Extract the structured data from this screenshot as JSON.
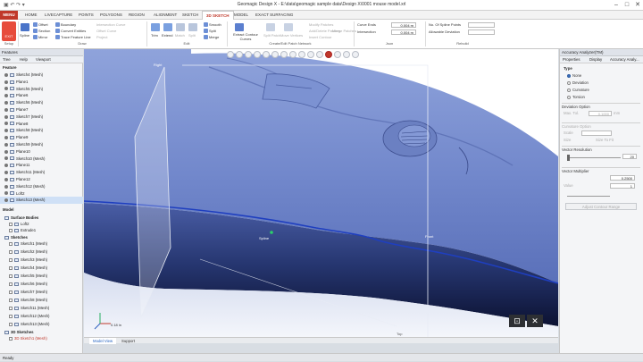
{
  "window": {
    "title": "Geomagic Design X - E:\\data\\geomagic sample data\\Design X\\0001 mouse model.xrl",
    "quick_access": "▣ ↶ ↷ ▾",
    "minimize": "–",
    "maximize": "□",
    "close": "✕"
  },
  "menu": {
    "menu_button": "MENU",
    "tabs": [
      "HOME",
      "LIVECAPTURE",
      "POINTS",
      "POLYGONS",
      "REGION",
      "ALIGNMENT",
      "SKETCH",
      "3D SKETCH",
      "MODEL",
      "EXACT SURFACING"
    ],
    "active_tab": "3D SKETCH"
  },
  "ribbon": {
    "exit_label": "EXIT",
    "setup_label": "Setup",
    "draw_label": "Draw",
    "edit_label": "Edit",
    "create_label": "Create/Edit Patch Network",
    "json_label": "Json",
    "rebuild_label": "Rebuild",
    "spline_label": "Spline",
    "draw_items": [
      "Offset",
      "Section",
      "Mirror",
      "Boundary",
      "Convert Entities",
      "Trace Feature Line"
    ],
    "draw_dim_items": [
      "Intersection Curve",
      "Offset Curve",
      "Project"
    ],
    "edit_items": [
      "Trim",
      "Extend",
      "Match",
      "Split",
      "Smooth",
      "Split",
      "Merge"
    ],
    "extract_label": "Extract Contour Curves",
    "create_items": [
      "Split Patch",
      "Move Vertices",
      "Modify Patches",
      "Add/Delete Patches",
      "Insert Contour",
      "Merge Patches"
    ],
    "curve_ends_label": "Curve Ends",
    "curve_ends_value": "0.004 m",
    "intersection_label": "Intersection",
    "intersection_value": "0.004 m",
    "spline_points_label": "No. Of Spline Points",
    "allowable_deviation_label": "Allowable Deviation"
  },
  "left_panel": {
    "header": "Features",
    "tabs": [
      "Tree",
      "Help",
      "Viewport"
    ],
    "feature_label": "Feature",
    "features": [
      "Sketch4 (Mesh)",
      "Plane1",
      "Sketch5 (Mesh)",
      "Plane6",
      "Sketch6 (Mesh)",
      "Plane7",
      "Sketch7 (Mesh)",
      "Plane8",
      "Sketch8 (Mesh)",
      "Plane9",
      "Sketch9 (Mesh)",
      "Plane10",
      "Sketch10 (Mesh)",
      "Plane11",
      "Sketch11 (Mesh)",
      "Plane12",
      "Sketch12 (Mesh)",
      "Loft2",
      "Sketch13 (Mesh)"
    ],
    "model_label": "Model",
    "surface_bodies_label": "Surface Bodies",
    "surface_bodies": [
      "Loft2",
      "Extrude1"
    ],
    "sketches_label": "Sketches",
    "sketches": [
      "Sketch1 (Mesh)",
      "Sketch2 (Mesh)",
      "Sketch3 (Mesh)",
      "Sketch4 (Mesh)",
      "Sketch5 (Mesh)",
      "Sketch6 (Mesh)",
      "Sketch7 (Mesh)",
      "Sketch8 (Mesh)",
      "Sketch11 (Mesh)",
      "Sketch12 (Mesh)",
      "Sketch13 (Mesh)"
    ],
    "sketches3d_label": "3D Sketches",
    "sketches3d": [
      "3D Sketch1 (Mesh)"
    ]
  },
  "viewport": {
    "label_right": "Right",
    "label_spline": "Spline",
    "label_front": "Front",
    "label_top": "Top",
    "scale_text": "0.18 in",
    "mesh_color": "#6f86c8",
    "accent_color": "#1f3fbf"
  },
  "right_panel": {
    "header": "Accuracy Analyzer(TM)",
    "tabs": [
      "Properties",
      "Display",
      "Accuracy Analy..."
    ],
    "type_label": "Type",
    "types": [
      "None",
      "Deviation",
      "Curvature",
      "Torsion"
    ],
    "selected_type": "None",
    "deviation_option_label": "Deviation Option",
    "max_tol_label": "Max. Tol.",
    "max_tol_value": "0.1000",
    "unit_label": "mm",
    "curvature_option_label": "Curvature Option",
    "scale_label": "Scale",
    "size_label": "Size",
    "fit_label": "Size To Fit",
    "vector_resolution_label": "Vector Resolution",
    "vector_resolution_value": "20",
    "vector_multiplier_label": "Vector Multiplier",
    "vector_multiplier_value": "0.2500",
    "value_label": "Value",
    "value_value": "1",
    "adjust_button": "Adjust Contour Range"
  },
  "bottom_tabs": {
    "tabs": [
      "Model View",
      "Support"
    ],
    "active": "Model View"
  },
  "status": {
    "text": "Ready",
    "logo_e": "⊡",
    "logo_x": "✕"
  }
}
